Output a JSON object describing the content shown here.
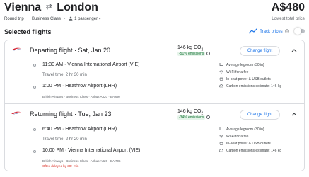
{
  "header": {
    "origin": "Vienna",
    "swap_symbol": "⇄",
    "destination": "London",
    "price": "A$480",
    "price_note": "Lowest total price",
    "trip_type": "Round trip",
    "cabin": "Business Class",
    "passengers": "1 passenger",
    "dropdown_glyph": "▾"
  },
  "section": {
    "title": "Selected flights",
    "track_label": "Track prices"
  },
  "flights": [
    {
      "title": "Departing flight · Sat, Jan 20",
      "co2": "146 kg CO",
      "co2_sub": "2",
      "emissions": "-51% emissions",
      "change_label": "Change flight",
      "dep": "11:30 AM · Vienna International Airport (VIE)",
      "travel": "Travel time: 2 hr 30 min",
      "arr": "1:00 PM · Heathrow Airport (LHR)",
      "meta": "British Airways · Business Class · Airbus A320 · BA 697",
      "delay": "",
      "amenities": [
        "Average legroom (30 in)",
        "Wi-Fi for a fee",
        "In-seat power & USB outlets",
        "Carbon emissions estimate: 146 kg"
      ]
    },
    {
      "title": "Returning flight · Tue, Jan 23",
      "co2": "146 kg CO",
      "co2_sub": "2",
      "emissions": "-34% emissions",
      "change_label": "Change flight",
      "dep": "6:40 PM · Heathrow Airport (LHR)",
      "travel": "Travel time: 2 hr 20 min",
      "arr": "10:00 PM · Vienna International Airport (VIE)",
      "meta": "British Airways · Business Class · Airbus A320 · BA 706",
      "delay": "Often delayed by 30+ min",
      "amenities": [
        "Average legroom (30 in)",
        "Wi-Fi for a fee",
        "In-seat power & USB outlets",
        "Carbon emissions estimate: 146 kg"
      ]
    }
  ],
  "colors": {
    "accent": "#1a73e8",
    "emissions_bg": "#e6f4ea",
    "emissions_text": "#137333",
    "delay": "#d93025",
    "airline_red": "#d21f2f",
    "airline_blue": "#1a3a8f"
  },
  "icons": [
    "person-icon",
    "trend-icon",
    "info-icon",
    "airline-logo",
    "chevron-up-icon",
    "legroom-icon",
    "wifi-icon",
    "power-icon",
    "emissions-icon"
  ]
}
